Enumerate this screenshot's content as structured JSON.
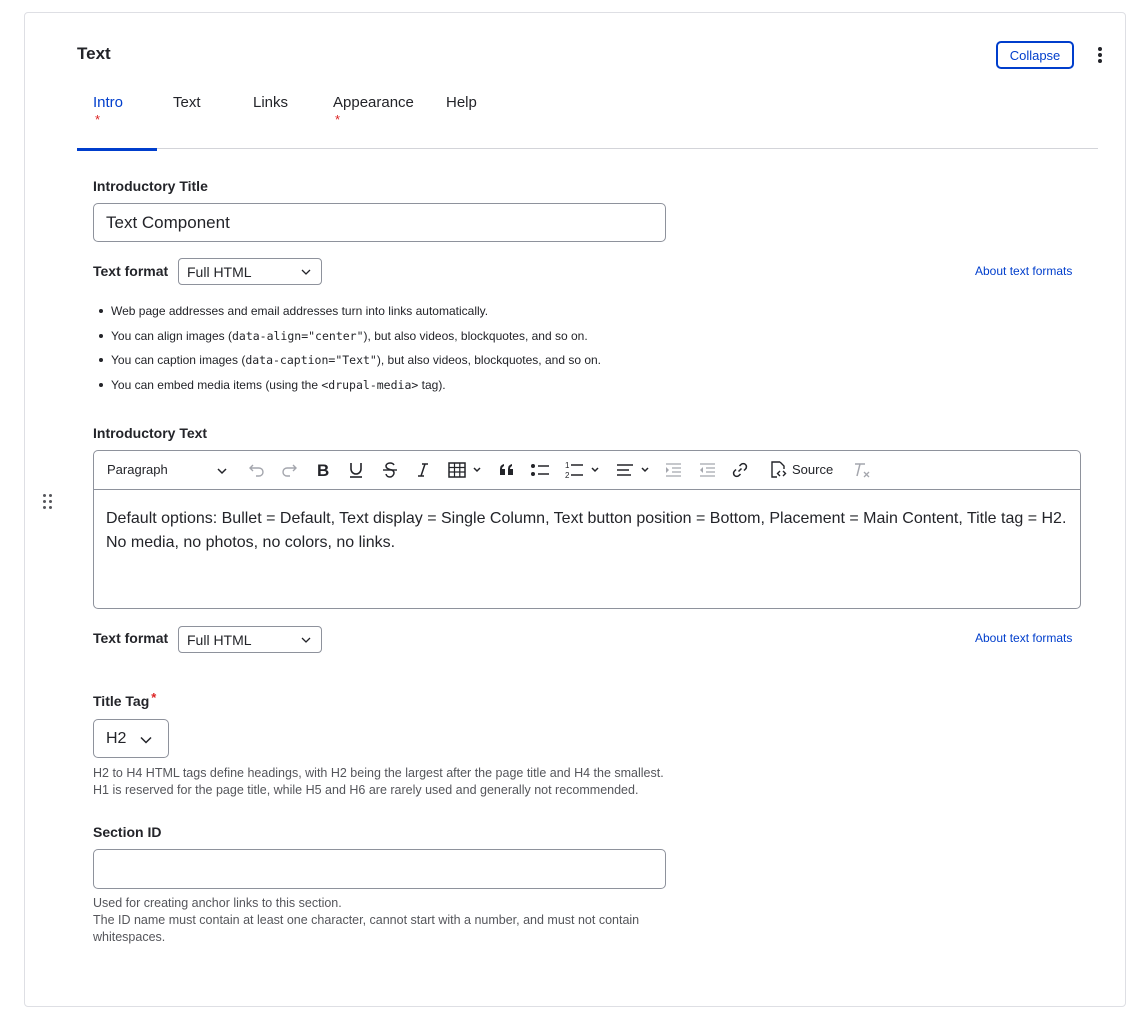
{
  "card": {
    "title": "Text",
    "collapse_label": "Collapse"
  },
  "tabs": [
    {
      "label": "Intro",
      "required": "*",
      "active": true
    },
    {
      "label": "Text",
      "required": "",
      "active": false
    },
    {
      "label": "Links",
      "required": "",
      "active": false
    },
    {
      "label": "Appearance",
      "required": "*",
      "active": false
    },
    {
      "label": "Help",
      "required": "",
      "active": false
    }
  ],
  "intro_title": {
    "label": "Introductory Title",
    "value": "Text Component"
  },
  "format1": {
    "label": "Text format",
    "selected": "Full HTML",
    "about_link": "About text formats"
  },
  "tips": {
    "t1": "Web page addresses and email addresses turn into links automatically.",
    "t2_pre": "You can align images (",
    "t2_code": "data-align=\"center\"",
    "t2_post": "), but also videos, blockquotes, and so on.",
    "t3_pre": "You can caption images (",
    "t3_code": "data-caption=\"Text\"",
    "t3_post": "), but also videos, blockquotes, and so on.",
    "t4_pre": "You can embed media items (using the ",
    "t4_code": "<drupal-media>",
    "t4_post": " tag)."
  },
  "intro_text": {
    "label": "Introductory Text",
    "paragraph_select": "Paragraph",
    "source_label": "Source",
    "content": "Default options: Bullet = Default, Text display = Single Column, Text button position = Bottom, Placement = Main Content, Title tag = H2. No media, no photos, no colors, no links."
  },
  "format2": {
    "label": "Text format",
    "selected": "Full HTML",
    "about_link": "About text formats"
  },
  "title_tag": {
    "label": "Title Tag",
    "required": "*",
    "selected": "H2",
    "help_line1": "H2 to H4 HTML tags define headings, with H2 being the largest after the page title and H4 the smallest.",
    "help_line2": "H1 is reserved for the page title, while H5 and H6 are rarely used and generally not recommended."
  },
  "section_id": {
    "label": "Section ID",
    "value": "",
    "help_line1": "Used for creating anchor links to this section.",
    "help_line2": "The ID name must contain at least one character, cannot start with a number, and must not contain",
    "help_line3": "whitespaces."
  },
  "colors": {
    "accent": "#003ecc",
    "required": "#dc2323",
    "border": "#8e929c",
    "text": "#232429"
  }
}
